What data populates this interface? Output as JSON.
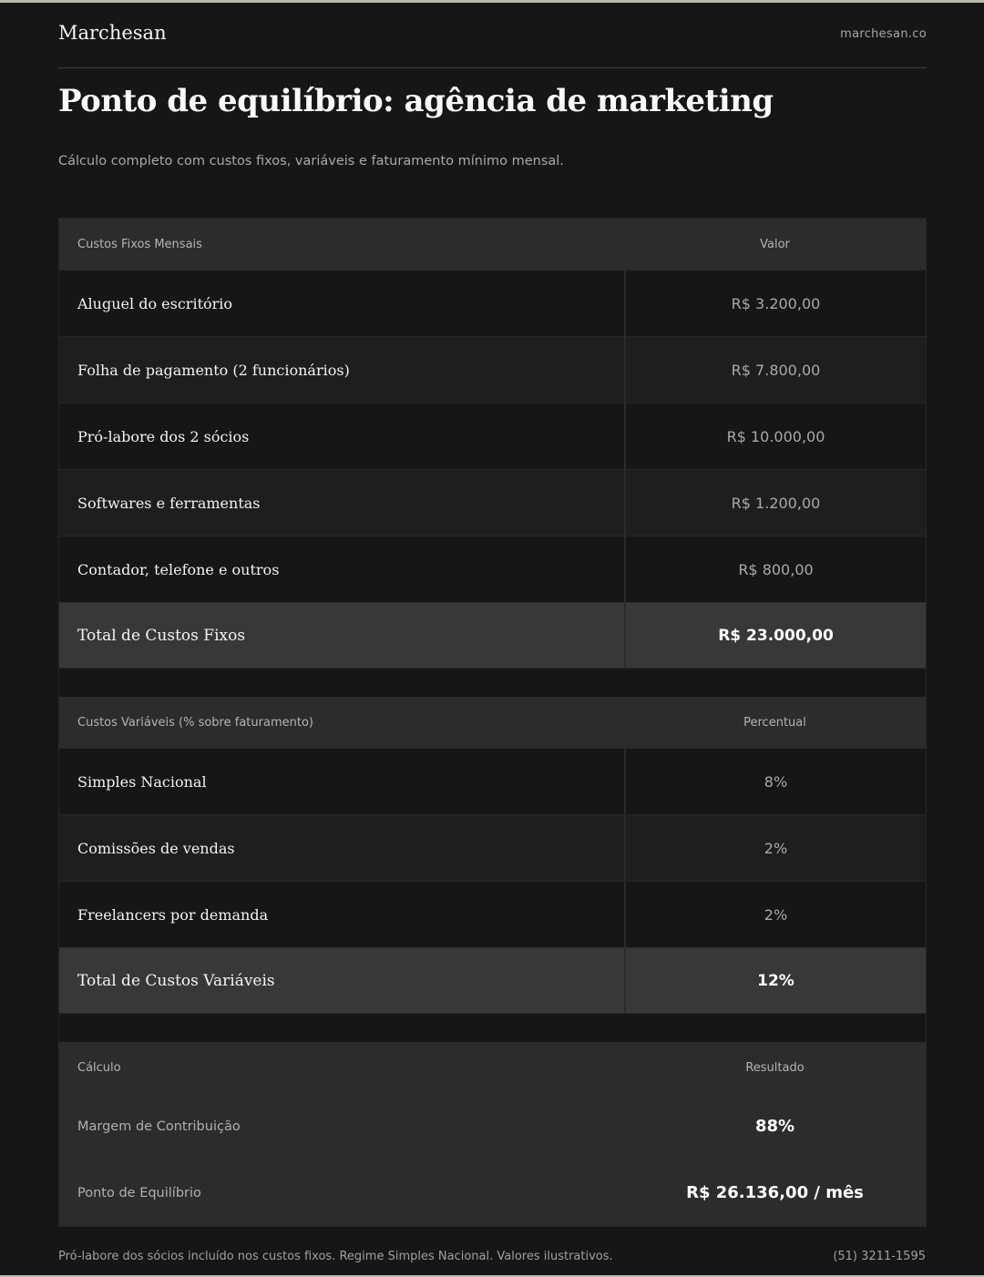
{
  "header": {
    "brand": "Marchesan",
    "site": "marchesan.co"
  },
  "page": {
    "title": "Ponto de equilíbrio: agência de marketing",
    "subtitle": "Cálculo completo com custos fixos, variáveis e faturamento mínimo mensal."
  },
  "fixed_costs": {
    "header_label": "Custos Fixos Mensais",
    "header_value": "Valor",
    "items": [
      {
        "label": "Aluguel do escritório",
        "value": "R$ 3.200,00"
      },
      {
        "label": "Folha de pagamento (2 funcionários)",
        "value": "R$ 7.800,00"
      },
      {
        "label": "Pró-labore dos 2 sócios",
        "value": "R$ 10.000,00"
      },
      {
        "label": "Softwares e ferramentas",
        "value": "R$ 1.200,00"
      },
      {
        "label": "Contador, telefone e outros",
        "value": "R$ 800,00"
      }
    ],
    "total_label": "Total de Custos Fixos",
    "total_value": "R$ 23.000,00"
  },
  "variable_costs": {
    "header_label": "Custos Variáveis (% sobre faturamento)",
    "header_value": "Percentual",
    "items": [
      {
        "label": "Simples Nacional",
        "value": "8%"
      },
      {
        "label": "Comissões de vendas",
        "value": "2%"
      },
      {
        "label": "Freelancers por demanda",
        "value": "2%"
      }
    ],
    "total_label": "Total de Custos Variáveis",
    "total_value": "12%"
  },
  "calculation": {
    "header_label": "Cálculo",
    "header_value": "Resultado",
    "items": [
      {
        "label": "Margem de Contribuição",
        "value": "88%"
      },
      {
        "label": "Ponto de Equilíbrio",
        "value": "R$ 26.136,00 / mês"
      }
    ]
  },
  "footer": {
    "note": "Pró-labore dos sócios incluído nos custos fixos. Regime Simples Nacional. Valores ilustrativos.",
    "phone": "(51) 3211-1595"
  }
}
